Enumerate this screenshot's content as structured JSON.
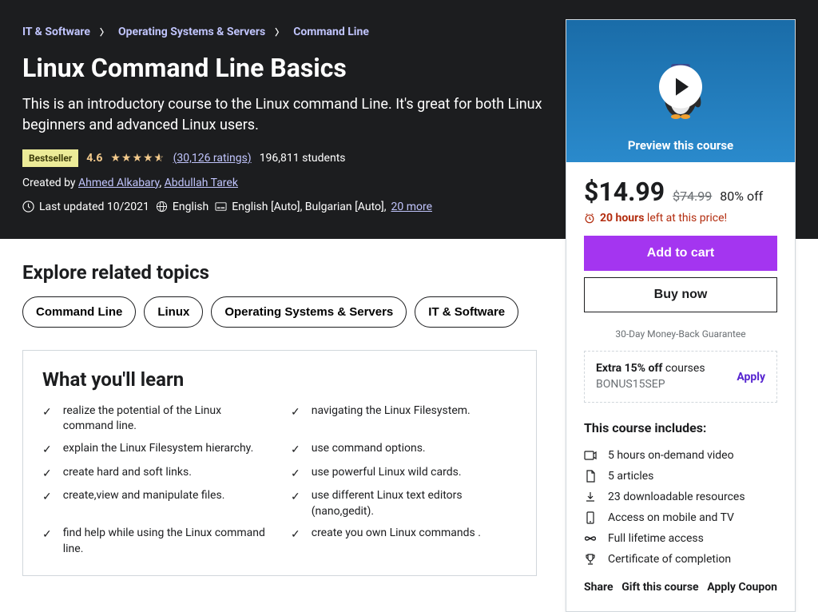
{
  "breadcrumb": {
    "items": [
      "IT & Software",
      "Operating Systems & Servers",
      "Command Line"
    ]
  },
  "hero": {
    "title": "Linux Command Line Basics",
    "subtitle": "This is an introductory course to the Linux command Line. It's great for both Linux beginners and advanced Linux users.",
    "bestseller": "Bestseller",
    "rating": "4.6",
    "rating_count": "(30,126 ratings)",
    "students": "196,811 students",
    "created_by_label": "Created by ",
    "authors": [
      "Ahmed Alkabary",
      "Abdullah Tarek"
    ],
    "last_updated": "Last updated 10/2021",
    "language": "English",
    "captions": "English [Auto], Bulgarian [Auto],",
    "more_captions": "20 more"
  },
  "sidebar": {
    "preview_label": "Preview this course",
    "price": "$14.99",
    "original_price": "$74.99",
    "discount": "80% off",
    "urgency_bold": "20 hours",
    "urgency_rest": " left at this price!",
    "add_to_cart": "Add to cart",
    "buy_now": "Buy now",
    "guarantee": "30-Day Money-Back Guarantee",
    "coupon_title": "Extra 15% off",
    "coupon_sub": " courses",
    "coupon_code": "BONUS15SEP",
    "apply": "Apply",
    "includes_title": "This course includes:",
    "includes": [
      "5 hours on-demand video",
      "5 articles",
      "23 downloadable resources",
      "Access on mobile and TV",
      "Full lifetime access",
      "Certificate of completion"
    ],
    "share": "Share",
    "gift": "Gift this course",
    "coupon_link": "Apply Coupon"
  },
  "explore": {
    "title": "Explore related topics",
    "pills": [
      "Command Line",
      "Linux",
      "Operating Systems & Servers",
      "IT & Software"
    ]
  },
  "learn": {
    "title": "What you'll learn",
    "col1": [
      "realize the potential of the Linux command line.",
      "explain the Linux Filesystem hierarchy.",
      "create hard and soft links.",
      "create,view and manipulate files.",
      "find help while using the Linux command line."
    ],
    "col2": [
      "navigating the Linux Filesystem.",
      "use command options.",
      "use powerful Linux wild cards.",
      "use different Linux text editors (nano,gedit).",
      "create you own Linux commands ."
    ]
  }
}
